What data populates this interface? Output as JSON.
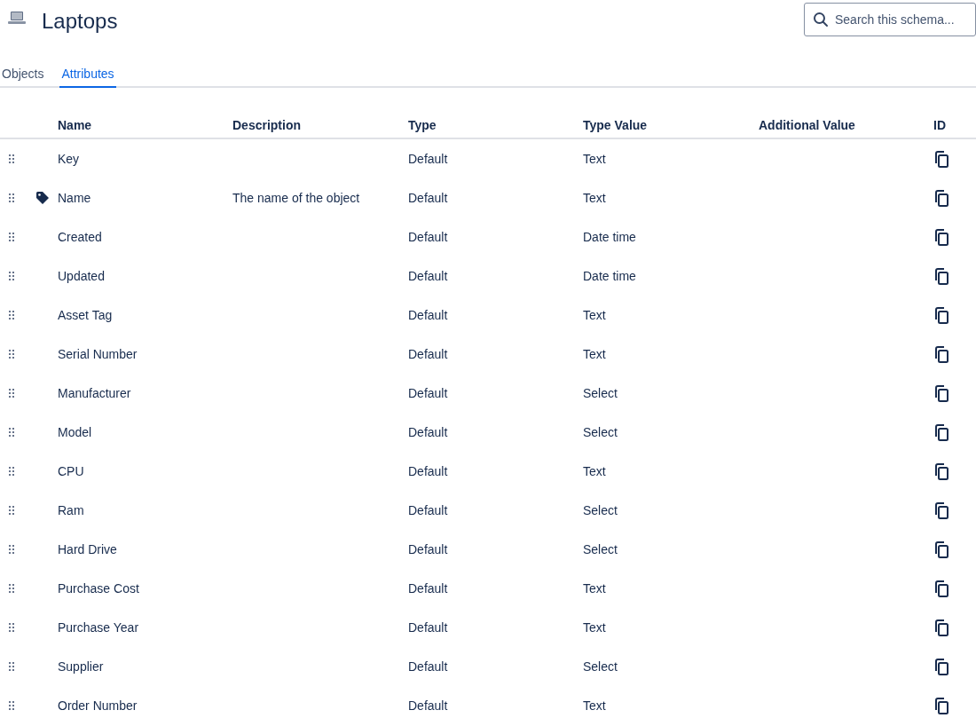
{
  "header": {
    "title": "Laptops",
    "search": {
      "placeholder": "Search this schema..."
    }
  },
  "tabs": [
    {
      "label": "Objects",
      "selected": false
    },
    {
      "label": "Attributes",
      "selected": true
    }
  ],
  "table": {
    "columns": [
      "Name",
      "Description",
      "Type",
      "Type Value",
      "Additional Value",
      "ID"
    ],
    "rows": [
      {
        "name": "Key",
        "label": false,
        "description": "",
        "type": "Default",
        "type_value": "Text"
      },
      {
        "name": "Name",
        "label": true,
        "description": "The name of the object",
        "type": "Default",
        "type_value": "Text"
      },
      {
        "name": "Created",
        "label": false,
        "description": "",
        "type": "Default",
        "type_value": "Date time"
      },
      {
        "name": "Updated",
        "label": false,
        "description": "",
        "type": "Default",
        "type_value": "Date time"
      },
      {
        "name": "Asset Tag",
        "label": false,
        "description": "",
        "type": "Default",
        "type_value": "Text"
      },
      {
        "name": "Serial Number",
        "label": false,
        "description": "",
        "type": "Default",
        "type_value": "Text"
      },
      {
        "name": "Manufacturer",
        "label": false,
        "description": "",
        "type": "Default",
        "type_value": "Select"
      },
      {
        "name": "Model",
        "label": false,
        "description": "",
        "type": "Default",
        "type_value": "Select"
      },
      {
        "name": "CPU",
        "label": false,
        "description": "",
        "type": "Default",
        "type_value": "Text"
      },
      {
        "name": "Ram",
        "label": false,
        "description": "",
        "type": "Default",
        "type_value": "Select"
      },
      {
        "name": "Hard Drive",
        "label": false,
        "description": "",
        "type": "Default",
        "type_value": "Select"
      },
      {
        "name": "Purchase Cost",
        "label": false,
        "description": "",
        "type": "Default",
        "type_value": "Text"
      },
      {
        "name": "Purchase Year",
        "label": false,
        "description": "",
        "type": "Default",
        "type_value": "Text"
      },
      {
        "name": "Supplier",
        "label": false,
        "description": "",
        "type": "Default",
        "type_value": "Select"
      },
      {
        "name": "Order Number",
        "label": false,
        "description": "",
        "type": "Default",
        "type_value": "Text"
      }
    ]
  }
}
